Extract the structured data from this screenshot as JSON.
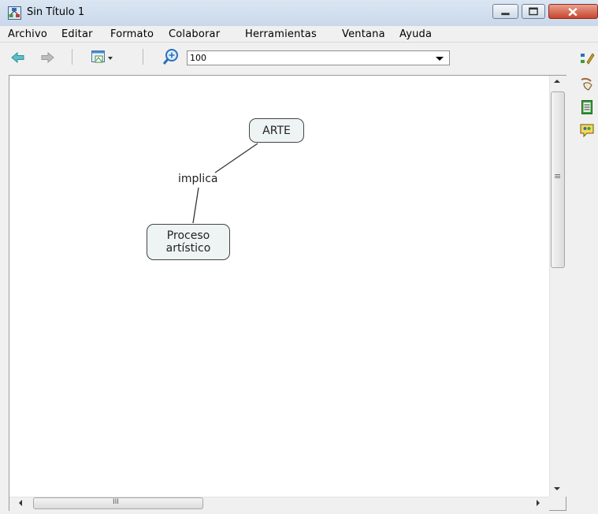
{
  "window": {
    "title": "Sin Título 1"
  },
  "menu": {
    "items": [
      "Archivo",
      "Editar",
      "Formato",
      "Colaborar",
      "Herramientas",
      "Ventana",
      "Ayuda"
    ]
  },
  "toolbar": {
    "zoom_value": "100"
  },
  "map": {
    "concepts": [
      {
        "text": "ARTE"
      },
      {
        "text": "Proceso artístico"
      }
    ],
    "link_label": "implica"
  },
  "scroll": {
    "h_grip": "III",
    "v_grip": "≡"
  },
  "colors": {
    "titlebar": "#c9d8ea",
    "close_button": "#c9452d",
    "concept_fill": "#eef3f3"
  },
  "icons": [
    "app-icon",
    "back-arrow-icon",
    "forward-arrow-icon",
    "view-icon",
    "zoom-icon",
    "properties-icon",
    "style-icon",
    "notes-icon",
    "collaboration-icon"
  ]
}
